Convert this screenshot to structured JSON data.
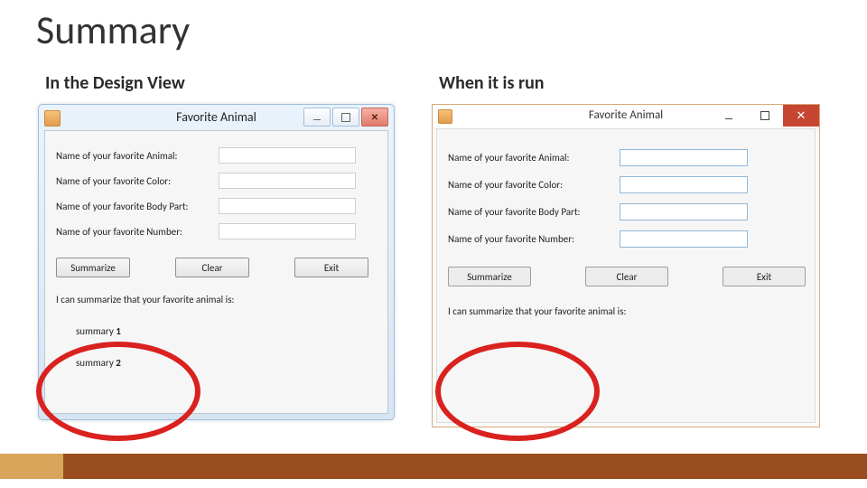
{
  "slide": {
    "title": "Summary",
    "sub_left": "In the Design View",
    "sub_right": "When it is run"
  },
  "form": {
    "window_title": "Favorite Animal",
    "labels": {
      "animal": "Name of your favorite Animal:",
      "color": "Name of your favorite Color:",
      "body": "Name of your favorite Body Part:",
      "number": "Name of your favorite Number:"
    },
    "buttons": {
      "summarize": "Summarize",
      "clear": "Clear",
      "exit": "Exit"
    },
    "summary_intro": "I can summarize that your favorite animal is:",
    "design_placeholders": {
      "s1a": "summary ",
      "s1b": "1",
      "s2a": "summary ",
      "s2b": "2"
    }
  },
  "window_controls": {
    "minimize": "minimize",
    "maximize": "maximize",
    "close": "close"
  }
}
